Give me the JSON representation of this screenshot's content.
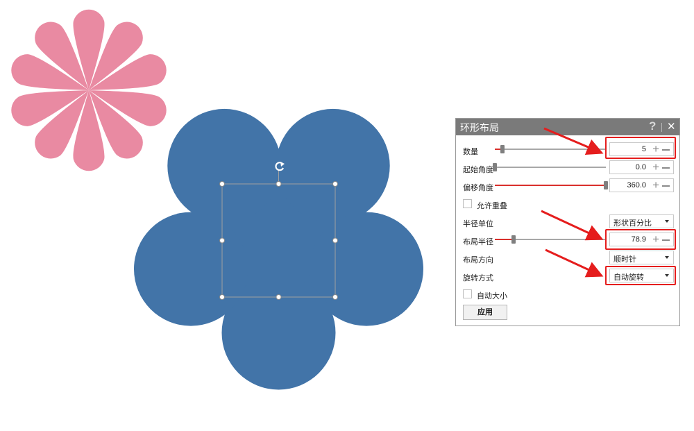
{
  "colors": {
    "petal_pink": "#e98aa2",
    "flower_blue": "#4274a8",
    "selection_border": "#a0a0a0",
    "titlebar": "#7a7a7a",
    "accent_red": "#d9302c",
    "annotation_red": "#e51d1d"
  },
  "panel": {
    "title": "环形布局",
    "help_icon": "?",
    "close_icon": "✕",
    "count": {
      "label": "数量",
      "value": "5",
      "slider_fraction": 0.07
    },
    "start_angle": {
      "label": "起始角度",
      "value": "0.0",
      "slider_fraction": 0.0
    },
    "offset_angle": {
      "label": "偏移角度",
      "value": "360.0",
      "slider_fraction": 1.0
    },
    "allow_overlap": {
      "label": "允许重叠",
      "checked": false
    },
    "radius_unit": {
      "label": "半径单位",
      "selected": "形状百分比"
    },
    "layout_radius": {
      "label": "布局半径",
      "value": "78.9",
      "slider_fraction": 0.17
    },
    "layout_direction": {
      "label": "布局方向",
      "selected": "顺时针"
    },
    "rotation_mode": {
      "label": "旋转方式",
      "selected": "自动旋转"
    },
    "auto_size": {
      "label": "自动大小",
      "checked": false
    },
    "apply_label": "应用"
  },
  "icons": {
    "rotate": "rotate-handle-icon",
    "plus": "plus-icon",
    "minus": "minus-icon",
    "dropdown": "chevron-down-icon"
  }
}
